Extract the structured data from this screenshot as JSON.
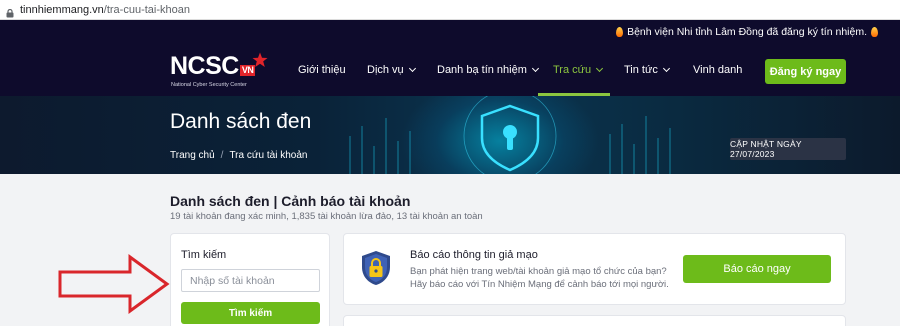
{
  "browser": {
    "url_domain": "tinnhiemmang.vn",
    "url_path": "/tra-cuu-tai-khoan"
  },
  "announcement": {
    "text": "Bệnh viện Nhi tỉnh Lâm Đồng đã đăng ký tín nhiệm."
  },
  "logo": {
    "brand": "NCSC",
    "country": "VN",
    "tagline": "National Cyber Security Center"
  },
  "nav": {
    "items": [
      {
        "label": "Giới thiệu",
        "has_dropdown": false
      },
      {
        "label": "Dịch vụ",
        "has_dropdown": true
      },
      {
        "label": "Danh bạ tín nhiệm",
        "has_dropdown": true
      },
      {
        "label": "Tra cứu",
        "has_dropdown": true,
        "active": true
      },
      {
        "label": "Tin tức",
        "has_dropdown": true
      },
      {
        "label": "Vinh danh",
        "has_dropdown": false
      }
    ],
    "cta_label": "Đăng ký ngay",
    "accent_color": "#6dbb1a"
  },
  "hero": {
    "title": "Danh sách đen",
    "breadcrumb": [
      "Trang chủ",
      "Tra cứu tài khoản"
    ],
    "updated_badge": "CẬP NHẬT NGÀY 27/07/2023"
  },
  "main": {
    "title": "Danh sách đen | Cảnh báo tài khoản",
    "subtitle": "19 tài khoản đang xác minh, 1,835 tài khoản lừa đảo, 13 tài khoản an toàn",
    "search": {
      "label": "Tìm kiếm",
      "placeholder": "Nhập số tài khoản",
      "button_label": "Tìm kiếm"
    },
    "report": {
      "title": "Báo cáo thông tin giả mạo",
      "description": "Bạn phát hiện trang web/tài khoản giả mạo tổ chức của bạn? Hãy báo cáo với Tín Nhiệm Mạng để cảnh báo tới mọi người.",
      "button_label": "Báo cáo ngay"
    }
  }
}
